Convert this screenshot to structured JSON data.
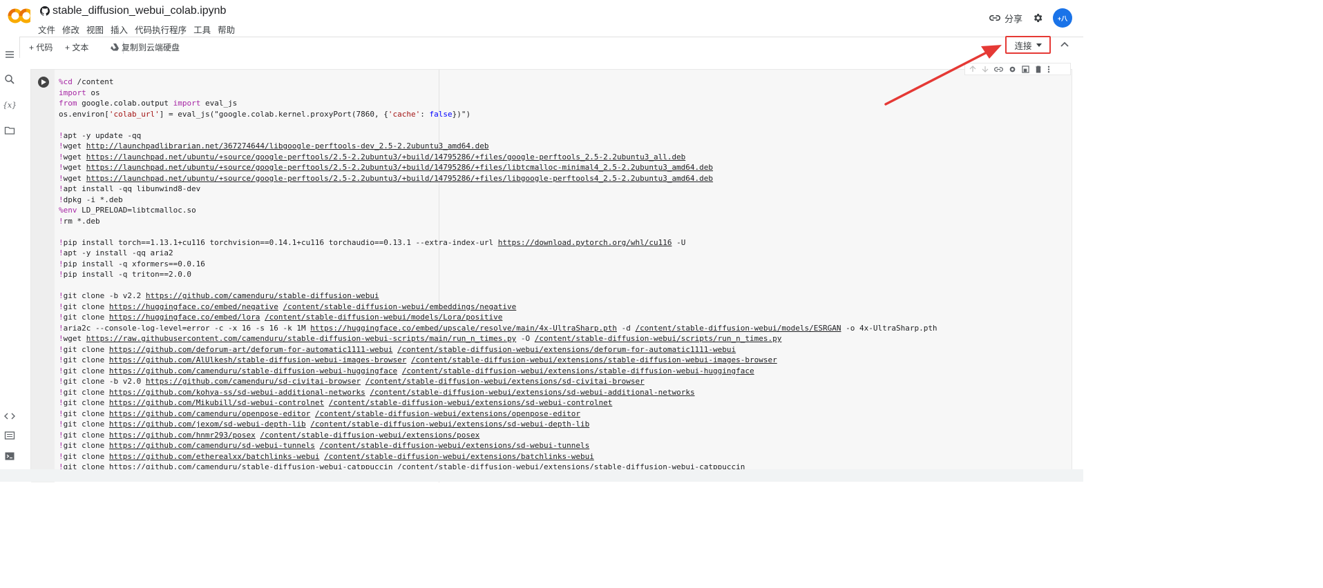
{
  "header": {
    "title": "stable_diffusion_webui_colab.ipynb",
    "menu": [
      "文件",
      "修改",
      "视图",
      "插入",
      "代码执行程序",
      "工具",
      "帮助"
    ],
    "share_label": "分享",
    "avatar_text": "+八\nGRETION"
  },
  "toolbar": {
    "add_code": "+ 代码",
    "add_text": "+ 文本",
    "copy_drive": "复制到云端硬盘",
    "connect": "连接"
  },
  "sidebar": {
    "icons": [
      "menu-icon",
      "search-icon",
      "variables-icon",
      "folder-icon",
      "code-snippets-icon",
      "command-palette-icon",
      "terminal-icon"
    ]
  },
  "code": {
    "lines": [
      "%cd /content",
      "import os",
      "from google.colab.output import eval_js",
      "os.environ['colab_url'] = eval_js(\"google.colab.kernel.proxyPort(7860, {'cache': false})\")",
      "",
      "!apt -y update -qq",
      "!wget http://launchpadlibrarian.net/367274644/libgoogle-perftools-dev_2.5-2.2ubuntu3_amd64.deb",
      "!wget https://launchpad.net/ubuntu/+source/google-perftools/2.5-2.2ubuntu3/+build/14795286/+files/google-perftools_2.5-2.2ubuntu3_all.deb",
      "!wget https://launchpad.net/ubuntu/+source/google-perftools/2.5-2.2ubuntu3/+build/14795286/+files/libtcmalloc-minimal4_2.5-2.2ubuntu3_amd64.deb",
      "!wget https://launchpad.net/ubuntu/+source/google-perftools/2.5-2.2ubuntu3/+build/14795286/+files/libgoogle-perftools4_2.5-2.2ubuntu3_amd64.deb",
      "!apt install -qq libunwind8-dev",
      "!dpkg -i *.deb",
      "%env LD_PRELOAD=libtcmalloc.so",
      "!rm *.deb",
      "",
      "!pip install torch==1.13.1+cu116 torchvision==0.14.1+cu116 torchaudio==0.13.1 --extra-index-url https://download.pytorch.org/whl/cu116 -U",
      "!apt -y install -qq aria2",
      "!pip install -q xformers==0.0.16",
      "!pip install -q triton==2.0.0",
      "",
      "!git clone -b v2.2 https://github.com/camenduru/stable-diffusion-webui",
      "!git clone https://huggingface.co/embed/negative /content/stable-diffusion-webui/embeddings/negative",
      "!git clone https://huggingface.co/embed/lora /content/stable-diffusion-webui/models/Lora/positive",
      "!aria2c --console-log-level=error -c -x 16 -s 16 -k 1M https://huggingface.co/embed/upscale/resolve/main/4x-UltraSharp.pth -d /content/stable-diffusion-webui/models/ESRGAN -o 4x-UltraSharp.pth",
      "!wget https://raw.githubusercontent.com/camenduru/stable-diffusion-webui-scripts/main/run_n_times.py -O /content/stable-diffusion-webui/scripts/run_n_times.py",
      "!git clone https://github.com/deforum-art/deforum-for-automatic1111-webui /content/stable-diffusion-webui/extensions/deforum-for-automatic1111-webui",
      "!git clone https://github.com/AlUlkesh/stable-diffusion-webui-images-browser /content/stable-diffusion-webui/extensions/stable-diffusion-webui-images-browser",
      "!git clone https://github.com/camenduru/stable-diffusion-webui-huggingface /content/stable-diffusion-webui/extensions/stable-diffusion-webui-huggingface",
      "!git clone -b v2.0 https://github.com/camenduru/sd-civitai-browser /content/stable-diffusion-webui/extensions/sd-civitai-browser",
      "!git clone https://github.com/kohya-ss/sd-webui-additional-networks /content/stable-diffusion-webui/extensions/sd-webui-additional-networks",
      "!git clone https://github.com/Mikubill/sd-webui-controlnet /content/stable-diffusion-webui/extensions/sd-webui-controlnet",
      "!git clone https://github.com/camenduru/openpose-editor /content/stable-diffusion-webui/extensions/openpose-editor",
      "!git clone https://github.com/jexom/sd-webui-depth-lib /content/stable-diffusion-webui/extensions/sd-webui-depth-lib",
      "!git clone https://github.com/hnmr293/posex /content/stable-diffusion-webui/extensions/posex",
      "!git clone https://github.com/camenduru/sd-webui-tunnels /content/stable-diffusion-webui/extensions/sd-webui-tunnels",
      "!git clone https://github.com/etherealxx/batchlinks-webui /content/stable-diffusion-webui/extensions/batchlinks-webui",
      "!git clone https://github.com/camenduru/stable-diffusion-webui-catppuccin /content/stable-diffusion-webui/extensions/stable-diffusion-webui-catppuccin"
    ]
  },
  "colors": {
    "accent_red": "#e53935",
    "logo_orange": "#f9ab00",
    "logo_dark": "#e8710a"
  }
}
